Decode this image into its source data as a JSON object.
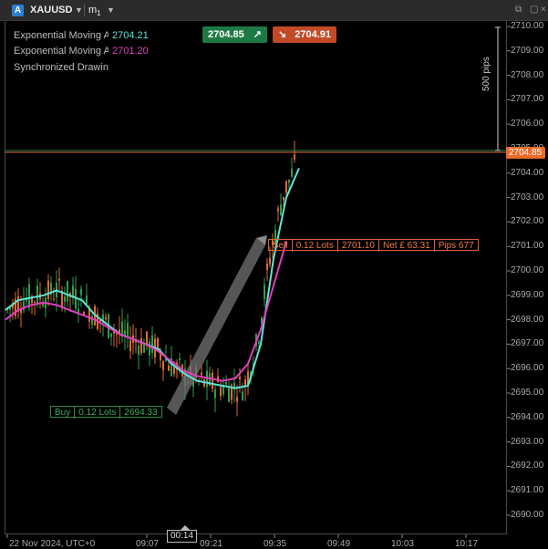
{
  "topbar": {
    "symbol_icon": "A",
    "symbol": "XAUUSD",
    "timeframe": "m",
    "timeframe_sub": "1",
    "icons": [
      "chevron-down-icon",
      "chevron-down-icon",
      "detach-icon",
      "maximize-icon",
      "close-icon"
    ]
  },
  "legend": [
    {
      "label": "Exponential Moving Average",
      "value": "2704.21",
      "color": "#5fe3d8"
    },
    {
      "label": "Exponential Moving Average",
      "value": "2701.20",
      "color": "#e03fbf"
    },
    {
      "label": "Synchronized Drawings",
      "value": ""
    }
  ],
  "quote": {
    "buy_price": "2704.85",
    "sell_price": "2704.91",
    "buy_color": "#1d7a45",
    "sell_color": "#c24a26"
  },
  "price_axis": {
    "labels": [
      "2710.00",
      "2709.00",
      "2708.00",
      "2707.00",
      "2706.00",
      "2705.00",
      "2704.00",
      "2703.00",
      "2702.00",
      "2701.00",
      "2700.00",
      "2699.00",
      "2698.00",
      "2697.00",
      "2696.00",
      "2695.00",
      "2694.00",
      "2693.00",
      "2692.00",
      "2691.00",
      "2690.00"
    ],
    "current_price": "2704.85",
    "current_color": "#ec6a2a"
  },
  "time_axis": {
    "labels": [
      "22 Nov 2024, UTC+0",
      "09:07",
      "09:21",
      "09:35",
      "09:49",
      "10:03",
      "10:17"
    ],
    "marker": "00:14"
  },
  "buy_position": {
    "side": "Buy",
    "lots": "0.12 Lots",
    "price": "2694.33"
  },
  "sell_position": {
    "side": "Sell",
    "lots": "0.12 Lots",
    "price": "2701.10",
    "net": "Net £ 63.31",
    "pips": "Pips 677"
  },
  "pips_measure": "500 pips",
  "chart_data": {
    "type": "line",
    "title": "",
    "xlabel": "",
    "ylabel": "",
    "ylim": [
      2689.6,
      2710.2
    ],
    "series": [
      {
        "values": [
          2698.4,
          2698.8,
          2698.9,
          2699.0,
          2699.2,
          2699.0,
          2698.8,
          2698.2,
          2697.8,
          2697.4,
          2697.2,
          2697.0,
          2696.8,
          2696.2,
          2695.8,
          2695.5,
          2695.4,
          2695.3,
          2695.2,
          2695.3,
          2697.0,
          2700.5,
          2703.0,
          2704.2
        ]
      },
      {
        "values": [
          2698.0,
          2698.4,
          2698.6,
          2698.7,
          2698.6,
          2698.4,
          2698.2,
          2698.0,
          2697.7,
          2697.4,
          2697.2,
          2697.0,
          2696.7,
          2696.3,
          2695.9,
          2695.7,
          2695.6,
          2695.5,
          2695.6,
          2696.2,
          2697.6,
          2699.4,
          2701.2
        ]
      }
    ]
  }
}
